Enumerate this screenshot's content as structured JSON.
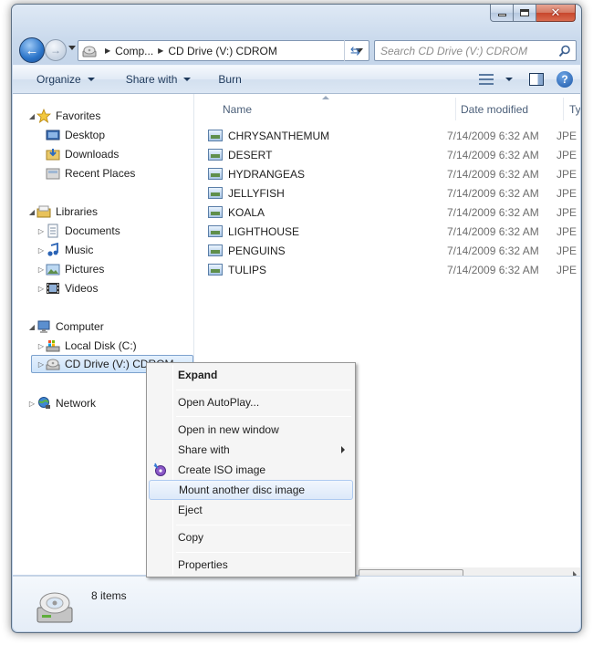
{
  "window": {
    "caption": {
      "minimize": "–",
      "maximize": "□",
      "close": "✕"
    }
  },
  "navigation": {
    "back_icon": "←",
    "forward_icon": "→",
    "address": {
      "crumb1": "Comp...",
      "crumb2": "CD Drive (V:) CDROM"
    },
    "refresh_icon": "⇆",
    "search_placeholder": "Search CD Drive (V:) CDROM"
  },
  "toolbar": {
    "organize": "Organize",
    "share_with": "Share with",
    "burn": "Burn",
    "help": "?"
  },
  "sidebar": {
    "favorites": "Favorites",
    "desktop": "Desktop",
    "downloads": "Downloads",
    "recent_places": "Recent Places",
    "libraries": "Libraries",
    "documents": "Documents",
    "music": "Music",
    "pictures": "Pictures",
    "videos": "Videos",
    "computer": "Computer",
    "local_disk": "Local Disk (C:)",
    "cd_drive": "CD Drive (V:) CDROM",
    "network": "Network"
  },
  "columns": {
    "name": "Name",
    "date_modified": "Date modified",
    "type": "Typ"
  },
  "files": [
    {
      "name": "CHRYSANTHEMUM",
      "date": "7/14/2009 6:32 AM",
      "type": "JPE"
    },
    {
      "name": "DESERT",
      "date": "7/14/2009 6:32 AM",
      "type": "JPE"
    },
    {
      "name": "HYDRANGEAS",
      "date": "7/14/2009 6:32 AM",
      "type": "JPE"
    },
    {
      "name": "JELLYFISH",
      "date": "7/14/2009 6:32 AM",
      "type": "JPE"
    },
    {
      "name": "KOALA",
      "date": "7/14/2009 6:32 AM",
      "type": "JPE"
    },
    {
      "name": "LIGHTHOUSE",
      "date": "7/14/2009 6:32 AM",
      "type": "JPE"
    },
    {
      "name": "PENGUINS",
      "date": "7/14/2009 6:32 AM",
      "type": "JPE"
    },
    {
      "name": "TULIPS",
      "date": "7/14/2009 6:32 AM",
      "type": "JPE"
    }
  ],
  "details": {
    "item_count": "8 items"
  },
  "context_menu": {
    "expand": "Expand",
    "open_autoplay": "Open AutoPlay...",
    "open_new_window": "Open in new window",
    "share_with": "Share with",
    "create_iso": "Create ISO image",
    "mount_another": "Mount another disc image",
    "eject": "Eject",
    "copy": "Copy",
    "properties": "Properties"
  }
}
